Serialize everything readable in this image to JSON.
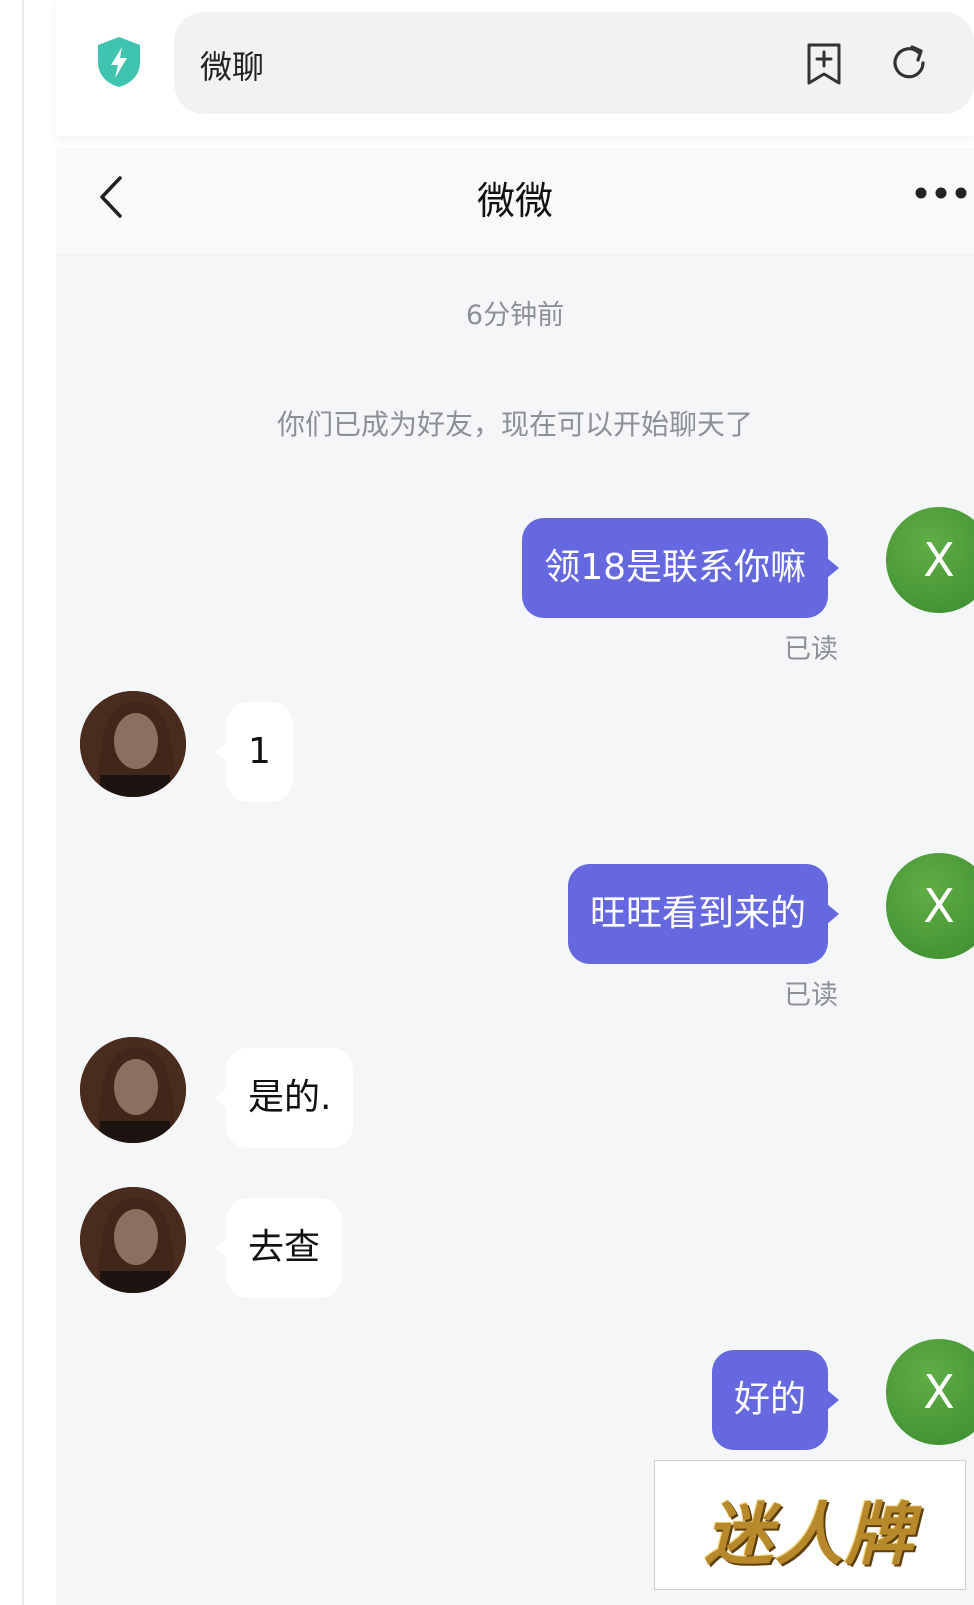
{
  "browser": {
    "address_text": "微聊"
  },
  "chat": {
    "title": "微微",
    "timestamp": "6分钟前",
    "system_message": "你们已成为好友，现在可以开始聊天了",
    "messages": [
      {
        "from": "me",
        "text": "领18是联系你嘛",
        "read": "已读",
        "avatar": "X"
      },
      {
        "from": "them",
        "text": "1"
      },
      {
        "from": "me",
        "text": "旺旺看到来的",
        "read": "已读",
        "avatar": "X"
      },
      {
        "from": "them",
        "text": "是的."
      },
      {
        "from": "them",
        "text": "去查"
      },
      {
        "from": "me",
        "text": "好的",
        "avatar": "X"
      }
    ]
  },
  "watermark": {
    "text": "迷人牌"
  },
  "colors": {
    "my_bubble": "#6668e0",
    "their_bubble": "#ffffff",
    "my_avatar": "#4d9b38",
    "shield": "#3fc4b0",
    "chat_bg": "#f5f6f8"
  },
  "icons": [
    "shield-bolt-icon",
    "bookmark-add-icon",
    "reload-icon",
    "back-chevron-icon",
    "more-dots-icon"
  ]
}
